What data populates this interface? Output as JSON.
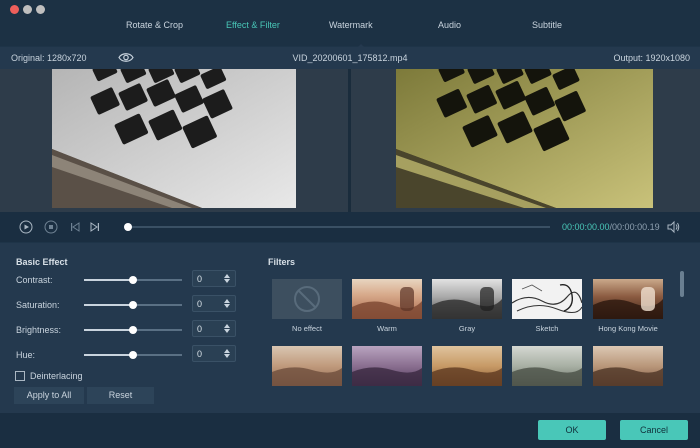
{
  "tabs": [
    {
      "label": "Rotate & Crop",
      "active": false
    },
    {
      "label": "Effect & Filter",
      "active": true
    },
    {
      "label": "Watermark",
      "active": false
    },
    {
      "label": "Audio",
      "active": false
    },
    {
      "label": "Subtitle",
      "active": false
    }
  ],
  "info": {
    "original": "Original: 1280x720",
    "filename": "VID_20200601_175812.mp4",
    "output": "Output: 1920x1080"
  },
  "playback": {
    "current": "00:00:00.00",
    "duration": "/00:00:00.19",
    "progress": 0.0
  },
  "basic_effect": {
    "title": "Basic Effect",
    "rows": [
      {
        "label": "Contrast:",
        "value": "0",
        "level": 0.5
      },
      {
        "label": "Saturation:",
        "value": "0",
        "level": 0.5
      },
      {
        "label": "Brightness:",
        "value": "0",
        "level": 0.5
      },
      {
        "label": "Hue:",
        "value": "0",
        "level": 0.5
      }
    ],
    "deinterlacing": "Deinterlacing",
    "deinterlacing_checked": false,
    "apply_all": "Apply to All",
    "reset": "Reset"
  },
  "filters": {
    "title": "Filters",
    "items": [
      {
        "label": "No effect",
        "icon": "no-effect-icon"
      },
      {
        "label": "Warm"
      },
      {
        "label": "Gray"
      },
      {
        "label": "Sketch"
      },
      {
        "label": "Hong Kong Movie"
      },
      {
        "label": ""
      },
      {
        "label": ""
      },
      {
        "label": ""
      },
      {
        "label": ""
      },
      {
        "label": ""
      }
    ]
  },
  "footer": {
    "ok": "OK",
    "cancel": "Cancel"
  },
  "colors": {
    "accent": "#49c7b8",
    "panel": "#24394e",
    "dark": "#1a2e41"
  }
}
